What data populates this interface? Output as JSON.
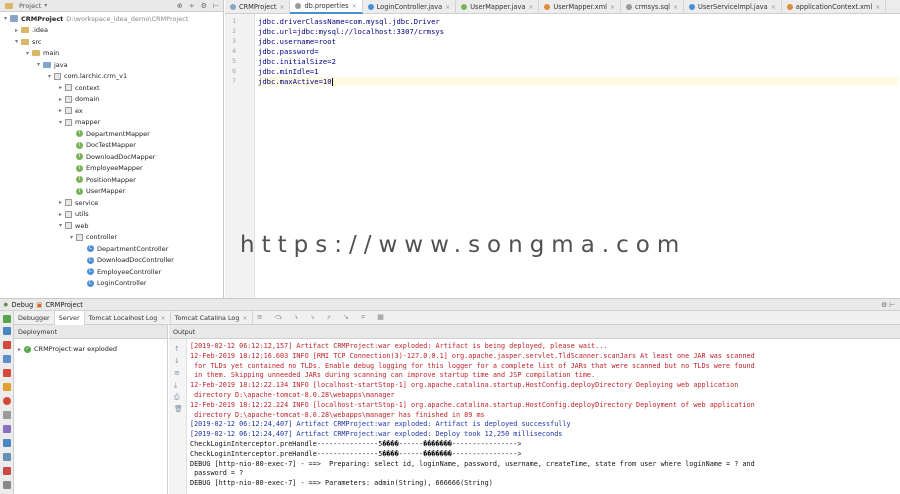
{
  "project": {
    "header_label": "Project",
    "rows": [
      {
        "indent": 0,
        "toggle": "▾",
        "icon": "project",
        "label": "CRMProject",
        "muted": "D:\\workspace_idea_demo\\CRMProject"
      },
      {
        "indent": 1,
        "toggle": "▸",
        "icon": "folder",
        "label": ".idea",
        "muted": ""
      },
      {
        "indent": 1,
        "toggle": "▾",
        "icon": "folder",
        "label": "src",
        "muted": ""
      },
      {
        "indent": 2,
        "toggle": "▾",
        "icon": "folder",
        "label": "main",
        "muted": ""
      },
      {
        "indent": 3,
        "toggle": "▾",
        "icon": "folder-blue",
        "label": "java",
        "muted": ""
      },
      {
        "indent": 4,
        "toggle": "▾",
        "icon": "package",
        "label": "com.larchic.crm_v1",
        "muted": ""
      },
      {
        "indent": 5,
        "toggle": "▸",
        "icon": "package",
        "label": "context",
        "muted": ""
      },
      {
        "indent": 5,
        "toggle": "▸",
        "icon": "package",
        "label": "domain",
        "muted": ""
      },
      {
        "indent": 5,
        "toggle": "▸",
        "icon": "package",
        "label": "ex",
        "muted": ""
      },
      {
        "indent": 5,
        "toggle": "▾",
        "icon": "package",
        "label": "mapper",
        "muted": ""
      },
      {
        "indent": 6,
        "toggle": "",
        "icon": "interface",
        "label": "DepartmentMapper",
        "muted": ""
      },
      {
        "indent": 6,
        "toggle": "",
        "icon": "interface",
        "label": "DocTestMapper",
        "muted": ""
      },
      {
        "indent": 6,
        "toggle": "",
        "icon": "interface",
        "label": "DownloadDocMapper",
        "muted": ""
      },
      {
        "indent": 6,
        "toggle": "",
        "icon": "interface",
        "label": "EmployeeMapper",
        "muted": ""
      },
      {
        "indent": 6,
        "toggle": "",
        "icon": "interface",
        "label": "PositionMapper",
        "muted": ""
      },
      {
        "indent": 6,
        "toggle": "",
        "icon": "interface",
        "label": "UserMapper",
        "muted": ""
      },
      {
        "indent": 5,
        "toggle": "▸",
        "icon": "package",
        "label": "service",
        "muted": ""
      },
      {
        "indent": 5,
        "toggle": "▸",
        "icon": "package",
        "label": "utils",
        "muted": ""
      },
      {
        "indent": 5,
        "toggle": "▾",
        "icon": "package",
        "label": "web",
        "muted": ""
      },
      {
        "indent": 6,
        "toggle": "▾",
        "icon": "package",
        "label": "controller",
        "muted": ""
      },
      {
        "indent": 7,
        "toggle": "",
        "icon": "class",
        "label": "DepartmentController",
        "muted": ""
      },
      {
        "indent": 7,
        "toggle": "",
        "icon": "class",
        "label": "DownloadDocController",
        "muted": ""
      },
      {
        "indent": 7,
        "toggle": "",
        "icon": "class",
        "label": "EmployeeController",
        "muted": ""
      },
      {
        "indent": 7,
        "toggle": "",
        "icon": "class",
        "label": "LoginController",
        "muted": ""
      }
    ]
  },
  "editor": {
    "tabs": [
      {
        "label": "CRMProject",
        "active": false,
        "color": "#8aa4c7"
      },
      {
        "label": "db.properties",
        "active": true,
        "color": "#9a9a9a"
      },
      {
        "label": "LoginController.java",
        "active": false,
        "color": "#4a8fd6"
      },
      {
        "label": "UserMapper.java",
        "active": false,
        "color": "#7cb35a"
      },
      {
        "label": "UserMapper.xml",
        "active": false,
        "color": "#e08a3c"
      },
      {
        "label": "crmsys.sql",
        "active": false,
        "color": "#9a9a9a"
      },
      {
        "label": "UserServiceImpl.java",
        "active": false,
        "color": "#4a8fd6"
      },
      {
        "label": "applicationContext.xml",
        "active": false,
        "color": "#e08a3c"
      }
    ],
    "lines": [
      {
        "num": "1",
        "text": "jdbc.driverClassName=com.mysql.jdbc.Driver"
      },
      {
        "num": "2",
        "text": "jdbc.url=jdbc:mysql://localhost:3307/crmsys"
      },
      {
        "num": "3",
        "text": "jdbc.username=root"
      },
      {
        "num": "4",
        "text": "jdbc.password="
      },
      {
        "num": "5",
        "text": "jdbc.initialSize=2"
      },
      {
        "num": "6",
        "text": "jdbc.minIdle=1"
      },
      {
        "num": "7",
        "text": "jdbc.maxActive=10"
      }
    ],
    "active_line": 7
  },
  "watermark": "https://www.songma.com",
  "debug": {
    "title": "Debug",
    "config": "CRMProject",
    "tabs": [
      {
        "label": "Debugger",
        "active": false
      },
      {
        "label": "Server",
        "active": true
      },
      {
        "label": "Tomcat Localhost Log",
        "active": false
      },
      {
        "label": "Tomcat Catalina Log",
        "active": false
      }
    ],
    "deployment_header": "Deployment",
    "deployment_item": "CRMProject:war exploded",
    "output_header": "Output",
    "log": [
      {
        "color": "red",
        "text": "[2019-02-12 06:12:12,157] Artifact CRMProject:war exploded: Artifact is being deployed, please wait..."
      },
      {
        "color": "red",
        "text": "12-Feb-2019 18:12:16.603 INFO [RMI TCP Connection(3)-127.0.0.1] org.apache.jasper.servlet.TldScanner.scanJars At least one JAR was scanned"
      },
      {
        "color": "red",
        "text": " for TLDs yet contained no TLDs. Enable debug logging for this logger for a complete list of JARs that were scanned but no TLDs were found"
      },
      {
        "color": "red",
        "text": " in them. Skipping unneeded JARs during scanning can improve startup time and JSP compilation time."
      },
      {
        "color": "red",
        "text": "12-Feb-2019 18:12:22.134 INFO [localhost-startStop-1] org.apache.catalina.startup.HostConfig.deployDirectory Deploying web application"
      },
      {
        "color": "red",
        "text": " directory D:\\apache-tomcat-8.0.28\\webapps\\manager"
      },
      {
        "color": "red",
        "text": "12-Feb-2019 18:12:22.224 INFO [localhost-startStop-1] org.apache.catalina.startup.HostConfig.deployDirectory Deployment of web application"
      },
      {
        "color": "red",
        "text": " directory D:\\apache-tomcat-8.0.28\\webapps\\manager has finished in 89 ms"
      },
      {
        "color": "blue",
        "text": "[2019-02-12 06:12:24,407] Artifact CRMProject:war exploded: Artifact is deployed successfully"
      },
      {
        "color": "blue",
        "text": "[2019-02-12 06:12:24,407] Artifact CRMProject:war exploded: Deploy took 12,250 milliseconds"
      },
      {
        "color": "black",
        "text": "CheckLoginInterceptor.preHandle---------------5����------�������---------------->"
      },
      {
        "color": "black",
        "text": "CheckLoginInterceptor.preHandle---------------5����------�������---------------->"
      },
      {
        "color": "black",
        "text": "DEBUG [http-nio-80-exec-7] - ==>  Preparing: select id, loginName, password, username, createTime, state from user where loginName = ? and"
      },
      {
        "color": "black",
        "text": " password = ?"
      },
      {
        "color": "black",
        "text": "DEBUG [http-nio-80-exec-7] - ==> Parameters: admin(String), 666666(String)"
      }
    ]
  }
}
